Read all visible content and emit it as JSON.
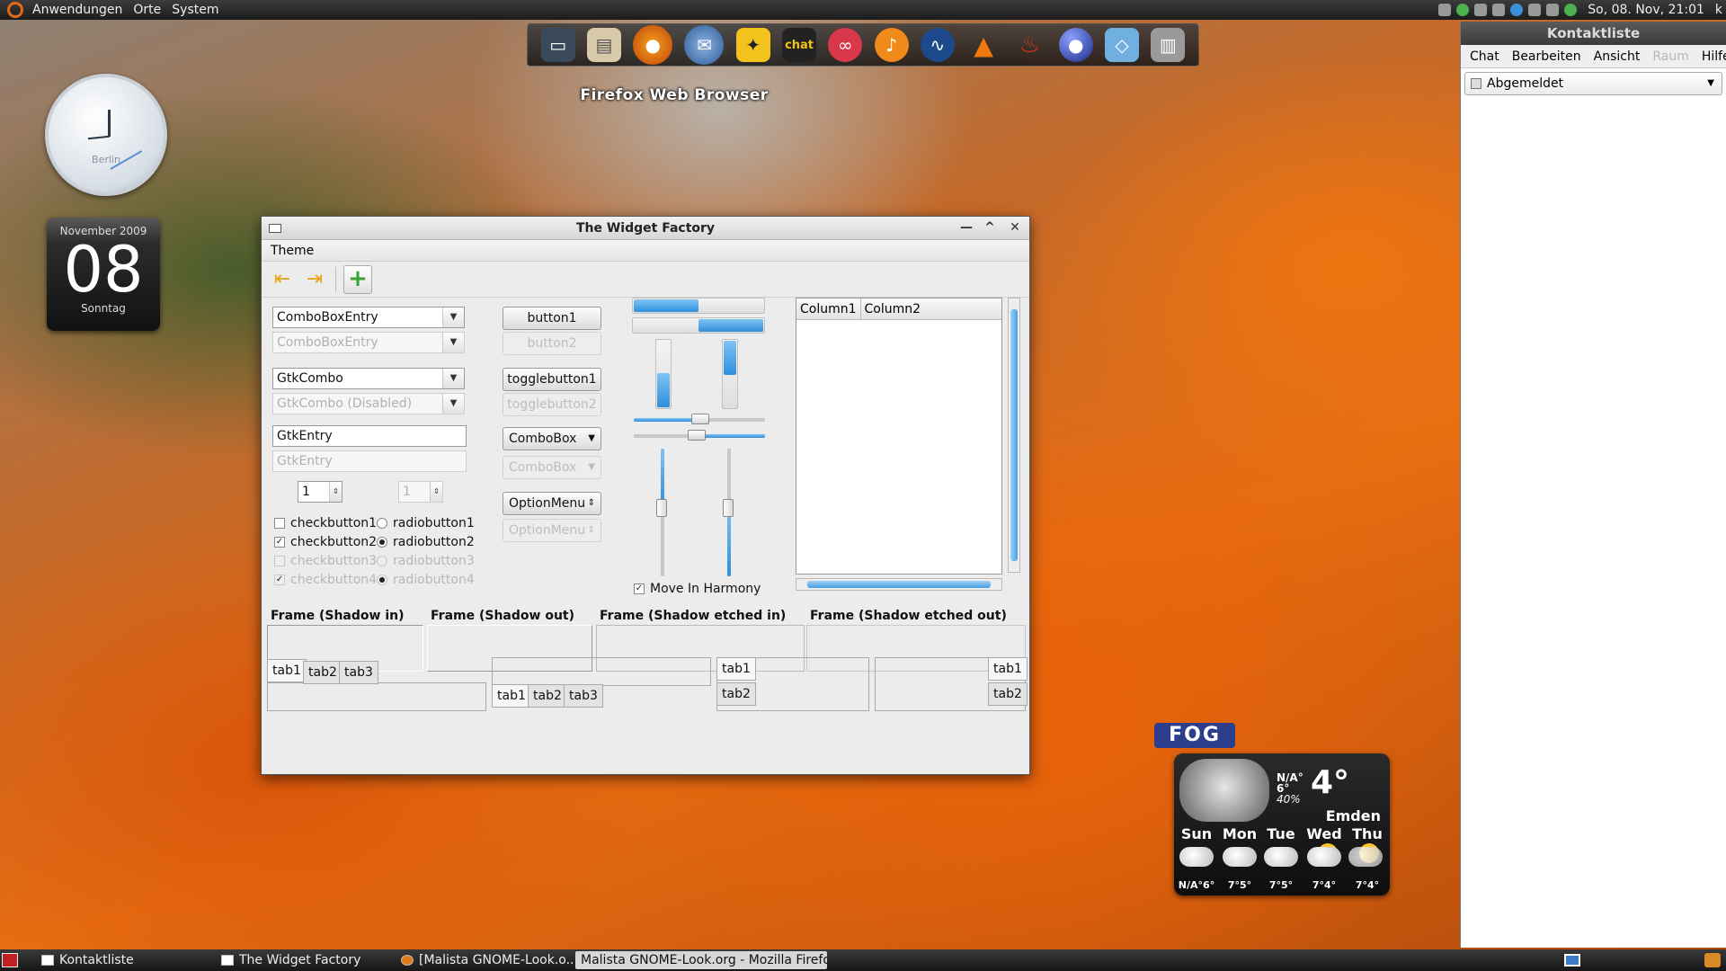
{
  "top_panel": {
    "menus": [
      "Anwendungen",
      "Orte",
      "System"
    ],
    "datetime": "So, 08. Nov, 21:01",
    "user_initial": "k"
  },
  "dock": {
    "tooltip": "Firefox Web Browser",
    "icons": [
      "monitor-icon",
      "folder-icon",
      "firefox-icon",
      "thunderbird-icon",
      "twitter-bird-icon",
      "chat-icon",
      "lastfm-icon",
      "songbird-icon",
      "network-icon",
      "vlc-icon",
      "flame-icon",
      "sphere-icon",
      "box-icon",
      "trash-icon"
    ],
    "chat_label": "chat"
  },
  "clock_widget": {
    "city": "Berlin"
  },
  "calendar_widget": {
    "month": "November 2009",
    "day": "08",
    "weekday": "Sonntag"
  },
  "widget_factory": {
    "title": "The Widget Factory",
    "menu": [
      "Theme"
    ],
    "combo_entry": "ComboBoxEntry",
    "combo_entry_disabled": "ComboBoxEntry",
    "gtk_combo": "GtkCombo",
    "gtk_combo_disabled": "GtkCombo (Disabled)",
    "gtk_entry": "GtkEntry",
    "gtk_entry_placeholder": "GtkEntry",
    "spin1": "1",
    "spin2": "1",
    "checks": [
      {
        "label": "checkbutton1",
        "checked": false,
        "disabled": false
      },
      {
        "label": "checkbutton2",
        "checked": true,
        "disabled": false
      },
      {
        "label": "checkbutton3",
        "checked": false,
        "disabled": true
      },
      {
        "label": "checkbutton4",
        "checked": true,
        "disabled": true
      }
    ],
    "radios": [
      {
        "label": "radiobutton1",
        "checked": false,
        "disabled": false
      },
      {
        "label": "radiobutton2",
        "checked": true,
        "disabled": false
      },
      {
        "label": "radiobutton3",
        "checked": false,
        "disabled": true
      },
      {
        "label": "radiobutton4",
        "checked": true,
        "disabled": true
      }
    ],
    "button1": "button1",
    "button2": "button2",
    "toggle1": "togglebutton1",
    "toggle2": "togglebutton2",
    "combobox": "ComboBox",
    "combobox_disabled": "ComboBox",
    "optionmenu": "OptionMenu",
    "optionmenu_disabled": "OptionMenu",
    "move_in_harmony": "Move In Harmony",
    "columns": [
      "Column1",
      "Column2"
    ],
    "frames": [
      "Frame (Shadow in)",
      "Frame (Shadow out)",
      "Frame (Shadow etched in)",
      "Frame (Shadow etched out)"
    ],
    "tabs": [
      "tab1",
      "tab2",
      "tab3"
    ]
  },
  "contact_list": {
    "title": "Kontaktliste",
    "menu": [
      "Chat",
      "Bearbeiten",
      "Ansicht",
      "Raum",
      "Hilfe"
    ],
    "status": "Abgemeldet"
  },
  "weather": {
    "condition": "FOG",
    "now_na": "N/A°",
    "now_low": "6°",
    "humidity": "40%",
    "temp": "4°",
    "city": "Emden",
    "days": [
      {
        "name": "Sun",
        "temps": "N/A°6°"
      },
      {
        "name": "Mon",
        "temps": "7°5°"
      },
      {
        "name": "Tue",
        "temps": "7°5°"
      },
      {
        "name": "Wed",
        "temps": "7°4°"
      },
      {
        "name": "Thu",
        "temps": "7°4°"
      }
    ]
  },
  "taskbar": {
    "tasks": [
      "Kontaktliste",
      "The Widget Factory",
      "[Malista GNOME-Look.o...",
      "Malista GNOME-Look.org - Mozilla Firefox"
    ]
  }
}
